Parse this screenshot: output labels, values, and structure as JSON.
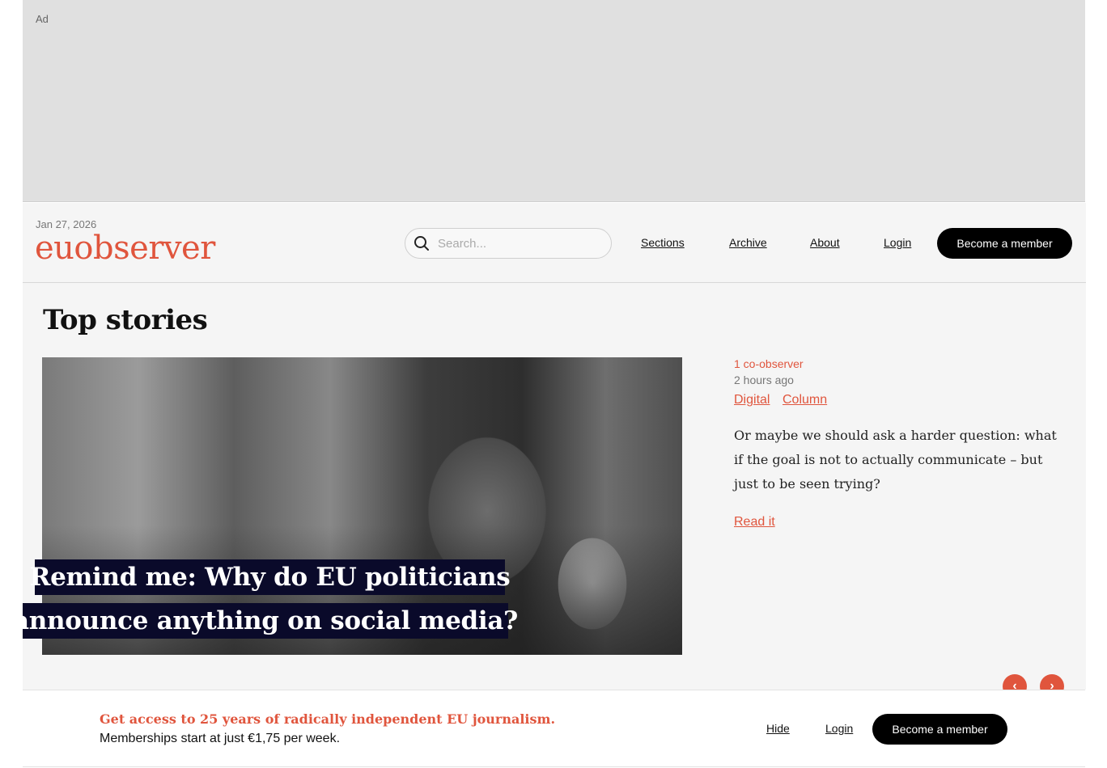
{
  "ad": {
    "label": "Ad"
  },
  "header": {
    "date": "Jan 27, 2026",
    "logo": "euobserver",
    "search_placeholder": "Search...",
    "nav": [
      "Sections",
      "Archive",
      "About",
      "Login"
    ],
    "cta": "Become a member"
  },
  "top_stories": {
    "title": "Top stories",
    "headline_lines": [
      "Remind me: Why do EU politicians",
      "announce anything on social media?"
    ],
    "author": "1 co-observer",
    "time": "2 hours ago",
    "tags": [
      "Digital",
      "Column"
    ],
    "summary": "Or maybe we should ask a harder question: what if the goal is not to actually communicate – but just to be seen trying?",
    "read_link": "Read it",
    "prev_arrow": "‹",
    "next_arrow": "›"
  },
  "banner": {
    "title": "Get access to 25 years of radically independent EU journalism.",
    "subtitle": "Memberships start at just €1,75 per week.",
    "hide": "Hide",
    "login": "Login",
    "cta": "Become a member"
  },
  "colors": {
    "accent": "#e0553d",
    "dark": "#000000",
    "headline_bg": "#0a0a2a"
  },
  "icons": {
    "search": "search-icon",
    "prev": "chevron-left-icon",
    "next": "chevron-right-icon"
  }
}
